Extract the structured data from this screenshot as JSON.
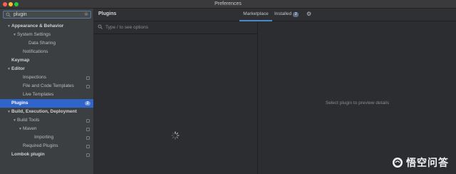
{
  "window": {
    "title": "Preferences"
  },
  "sidebar": {
    "search_value": "plugin",
    "items": [
      {
        "label": "Appearance & Behavior",
        "arrow": "▼",
        "indent": 0,
        "bold": true,
        "copy": false,
        "badge": ""
      },
      {
        "label": "System Settings",
        "arrow": "▼",
        "indent": 1,
        "bold": false,
        "copy": false,
        "badge": ""
      },
      {
        "label": "Data Sharing",
        "arrow": "",
        "indent": 3,
        "bold": false,
        "copy": false,
        "badge": ""
      },
      {
        "label": "Notifications",
        "arrow": "",
        "indent": 2,
        "bold": false,
        "copy": false,
        "badge": ""
      },
      {
        "label": "Keymap",
        "arrow": "",
        "indent": 0,
        "bold": true,
        "copy": false,
        "badge": ""
      },
      {
        "label": "Editor",
        "arrow": "▼",
        "indent": 0,
        "bold": true,
        "copy": false,
        "badge": ""
      },
      {
        "label": "Inspections",
        "arrow": "",
        "indent": 2,
        "bold": false,
        "copy": true,
        "badge": ""
      },
      {
        "label": "File and Code Templates",
        "arrow": "",
        "indent": 2,
        "bold": false,
        "copy": true,
        "badge": ""
      },
      {
        "label": "Live Templates",
        "arrow": "",
        "indent": 2,
        "bold": false,
        "copy": false,
        "badge": ""
      },
      {
        "label": "Plugins",
        "arrow": "",
        "indent": 0,
        "bold": true,
        "copy": false,
        "badge": "2",
        "selected": true
      },
      {
        "label": "Build, Execution, Deployment",
        "arrow": "▼",
        "indent": 0,
        "bold": true,
        "copy": false,
        "badge": ""
      },
      {
        "label": "Build Tools",
        "arrow": "▼",
        "indent": 1,
        "bold": false,
        "copy": true,
        "badge": ""
      },
      {
        "label": "Maven",
        "arrow": "▼",
        "indent": 2,
        "bold": false,
        "copy": true,
        "badge": ""
      },
      {
        "label": "Importing",
        "arrow": "",
        "indent": 4,
        "bold": false,
        "copy": true,
        "badge": ""
      },
      {
        "label": "Required Plugins",
        "arrow": "",
        "indent": 2,
        "bold": false,
        "copy": true,
        "badge": ""
      },
      {
        "label": "Lombok plugin",
        "arrow": "",
        "indent": 0,
        "bold": true,
        "copy": true,
        "badge": ""
      }
    ]
  },
  "main": {
    "title": "Plugins",
    "tabs": {
      "marketplace": "Marketplace",
      "installed": "Installed",
      "installed_count": "2"
    },
    "search_placeholder": "Type / to see options",
    "detail_placeholder": "Select plugin to preview details"
  },
  "watermark": {
    "text": "悟空问答"
  },
  "colors": {
    "selection": "#2f65ca",
    "tab_underline": "#4a88c7",
    "background": "#2b2d30",
    "sidebar": "#3c3f41"
  }
}
